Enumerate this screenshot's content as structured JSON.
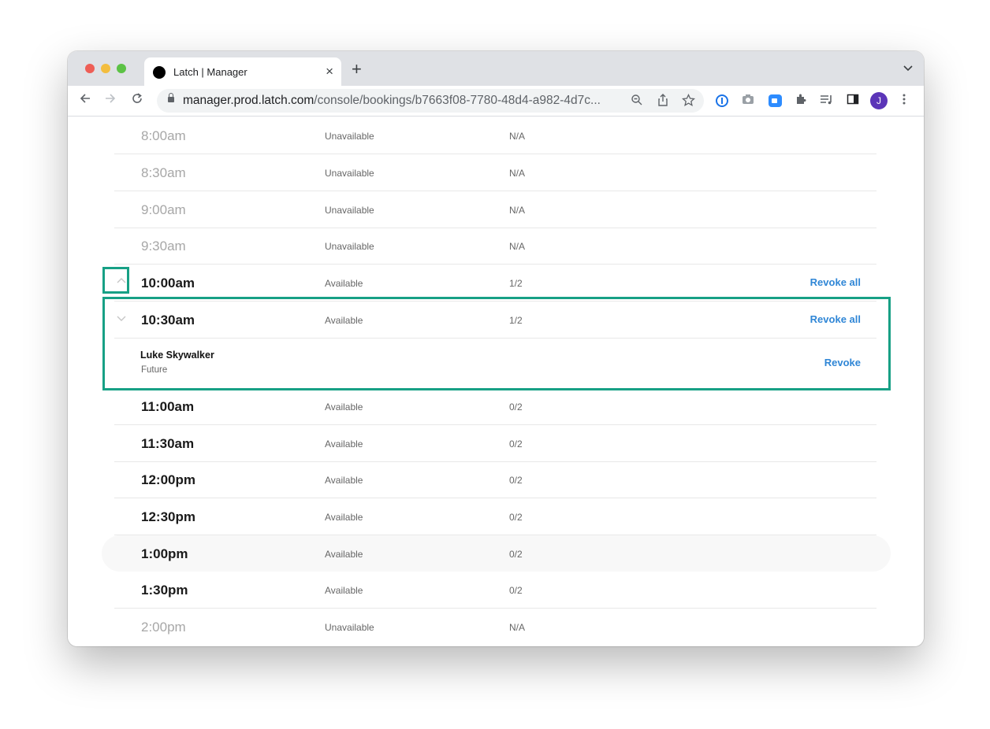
{
  "browser": {
    "tab_title": "Latch | Manager",
    "tab_close": "×",
    "new_tab": "+",
    "url_host": "manager.prod.latch.com",
    "url_path": "/console/bookings/b7663f08-7780-48d4-a982-4d7c...",
    "avatar_initial": "J",
    "icons": [
      "back-icon",
      "forward-icon",
      "reload-icon",
      "lock-icon",
      "zoom-out-icon",
      "share-icon",
      "star-icon",
      "onepassword-icon",
      "camera-icon",
      "zoom-video-icon",
      "extensions-icon",
      "reading-list-icon",
      "side-panel-icon",
      "kebab-menu-icon"
    ]
  },
  "slots": [
    {
      "time": "8:00am",
      "status": "Unavailable",
      "count": "N/A"
    },
    {
      "time": "8:30am",
      "status": "Unavailable",
      "count": "N/A"
    },
    {
      "time": "9:00am",
      "status": "Unavailable",
      "count": "N/A"
    },
    {
      "time": "9:30am",
      "status": "Unavailable",
      "count": "N/A"
    },
    {
      "time": "10:00am",
      "status": "Available",
      "count": "1/2",
      "action": "Revoke all"
    },
    {
      "time": "10:30am",
      "status": "Available",
      "count": "1/2",
      "action": "Revoke all"
    },
    {
      "time": "11:00am",
      "status": "Available",
      "count": "0/2"
    },
    {
      "time": "11:30am",
      "status": "Available",
      "count": "0/2"
    },
    {
      "time": "12:00pm",
      "status": "Available",
      "count": "0/2"
    },
    {
      "time": "12:30pm",
      "status": "Available",
      "count": "0/2"
    },
    {
      "time": "1:00pm",
      "status": "Available",
      "count": "0/2"
    },
    {
      "time": "1:30pm",
      "status": "Available",
      "count": "0/2"
    },
    {
      "time": "2:00pm",
      "status": "Unavailable",
      "count": "N/A"
    }
  ],
  "booking": {
    "name": "Luke Skywalker",
    "state": "Future",
    "action": "Revoke"
  }
}
